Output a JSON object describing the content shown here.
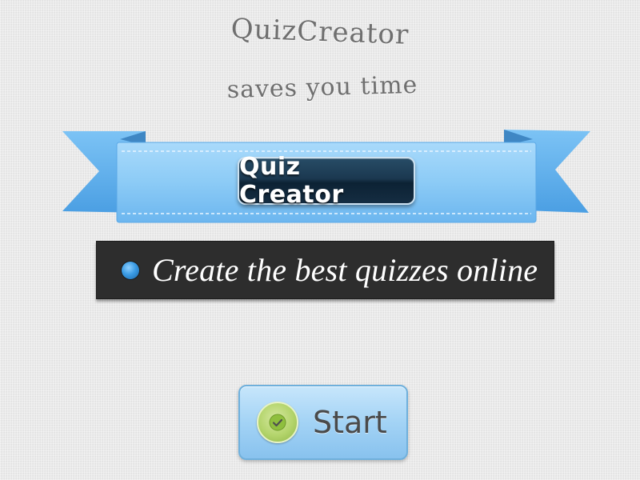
{
  "header": {
    "title": "QuizCreator",
    "tagline": "saves you time"
  },
  "ribbon": {
    "badge_label": "Quiz Creator",
    "color": "#5aaef0"
  },
  "banner": {
    "text": "Create the best quizzes online",
    "bullet_icon": "blue-dot-icon",
    "background": "#2d2d2d"
  },
  "start_button": {
    "label": "Start",
    "icon": "check-circle-icon"
  }
}
